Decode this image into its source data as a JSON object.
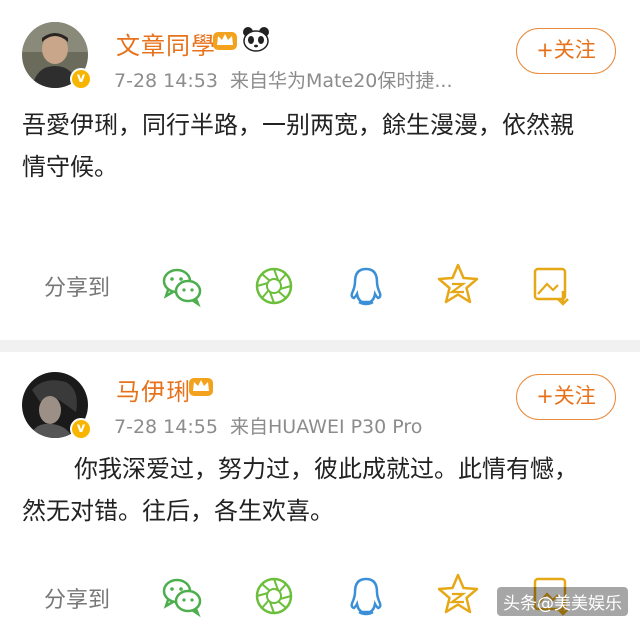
{
  "posts": [
    {
      "name": "文章同學",
      "time": "7-28 14:53",
      "source": "来自华为Mate20保时捷...",
      "follow_label": "+关注",
      "content_lines": [
        "吾愛伊琍，同行半路，一别两宽，餘生漫漫，依然親",
        "情守候。"
      ],
      "share_label": "分享到"
    },
    {
      "name": "马伊琍",
      "time": "7-28 14:55",
      "source": "来自HUAWEI P30 Pro",
      "follow_label": "+关注",
      "content_lines": [
        "你我深爱过，努力过，彼此成就过。此情有憾，",
        "然无对错。往后，各生欢喜。"
      ],
      "share_label": "分享到"
    }
  ],
  "share_icons": [
    "wechat-icon",
    "moments-icon",
    "qq-icon",
    "qzone-icon",
    "save-image-icon"
  ],
  "watermark": "头条@美美娱乐",
  "colors": {
    "accent": "#e8721c",
    "icon_green": "#4cae4c",
    "icon_blue": "#3a8fd6",
    "icon_gold": "#e6a817"
  }
}
